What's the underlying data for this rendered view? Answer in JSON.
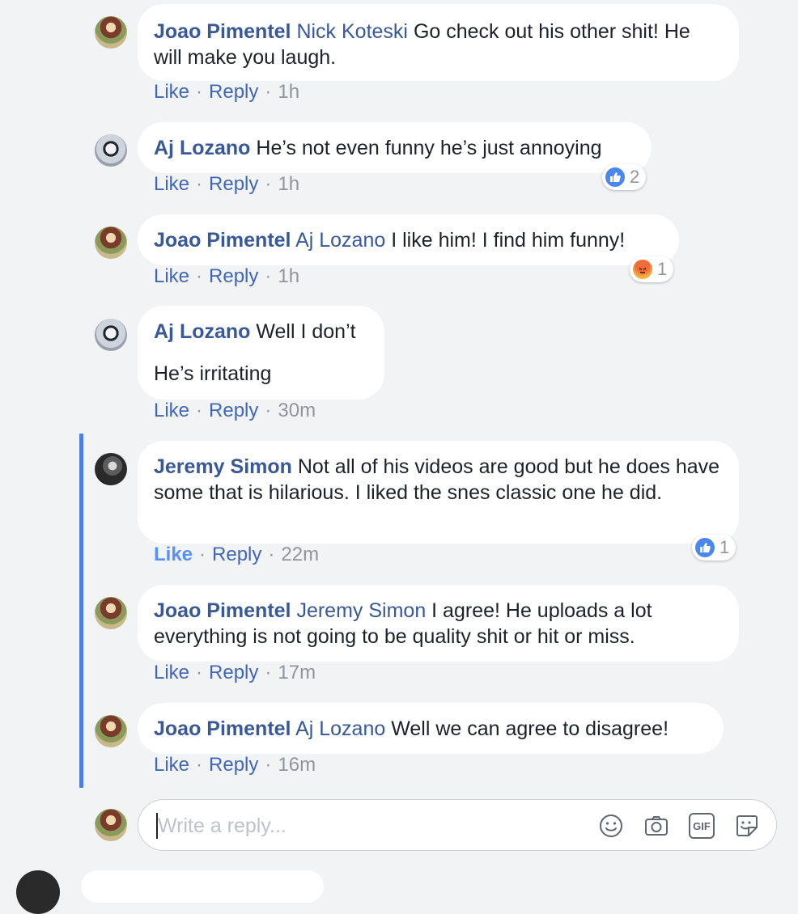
{
  "colors": {
    "link": "#385898",
    "action": "#4267b2",
    "liked": "#5890ff",
    "meta": "#90949c",
    "thread_line": "#4a80e0"
  },
  "comments": [
    {
      "author": "Joao Pimentel",
      "mention": "Nick Koteski",
      "text": " Go check out his other shit! He will make you laugh.",
      "like": "Like",
      "reply": "Reply",
      "time": "1h",
      "avatar": "joao-avatar"
    },
    {
      "author": "Aj Lozano",
      "mention": "",
      "text": " He’s not even funny he’s just annoying",
      "like": "Like",
      "reply": "Reply",
      "time": "1h",
      "avatar": "aj-avatar",
      "reaction": {
        "icon": "like-reaction-icon",
        "count": "2"
      }
    },
    {
      "author": "Joao Pimentel",
      "mention": "Aj Lozano",
      "text": " I like him! I find him funny!",
      "like": "Like",
      "reply": "Reply",
      "time": "1h",
      "avatar": "joao-avatar",
      "reaction": {
        "icon": "angry-reaction-icon",
        "count": "1"
      }
    },
    {
      "author": "Aj Lozano",
      "mention": "",
      "text": " Well I don’t",
      "text2": "He’s irritating",
      "like": "Like",
      "reply": "Reply",
      "time": "30m",
      "avatar": "aj-avatar"
    },
    {
      "author": "Jeremy Simon",
      "mention": "",
      "text": " Not all of his videos are good but he does have some that is hilarious. I liked the snes classic one he did.",
      "like": "Like",
      "reply": "Reply",
      "time": "22m",
      "avatar": "jeremy-avatar",
      "liked": true,
      "reaction": {
        "icon": "like-reaction-icon",
        "count": "1"
      }
    },
    {
      "author": "Joao Pimentel",
      "mention": "Jeremy Simon",
      "text": " I agree! He uploads a lot everything is not going to be quality shit or hit or miss.",
      "like": "Like",
      "reply": "Reply",
      "time": "17m",
      "avatar": "joao-avatar"
    },
    {
      "author": "Joao Pimentel",
      "mention": "Aj Lozano",
      "text": " Well we can agree to disagree!",
      "like": "Like",
      "reply": "Reply",
      "time": "16m",
      "avatar": "joao-avatar"
    }
  ],
  "reply_box": {
    "placeholder": "Write a reply...",
    "icons": [
      "emoji-icon",
      "camera-icon",
      "gif-icon",
      "sticker-icon"
    ],
    "gif_label": "GIF"
  },
  "separator": "·"
}
